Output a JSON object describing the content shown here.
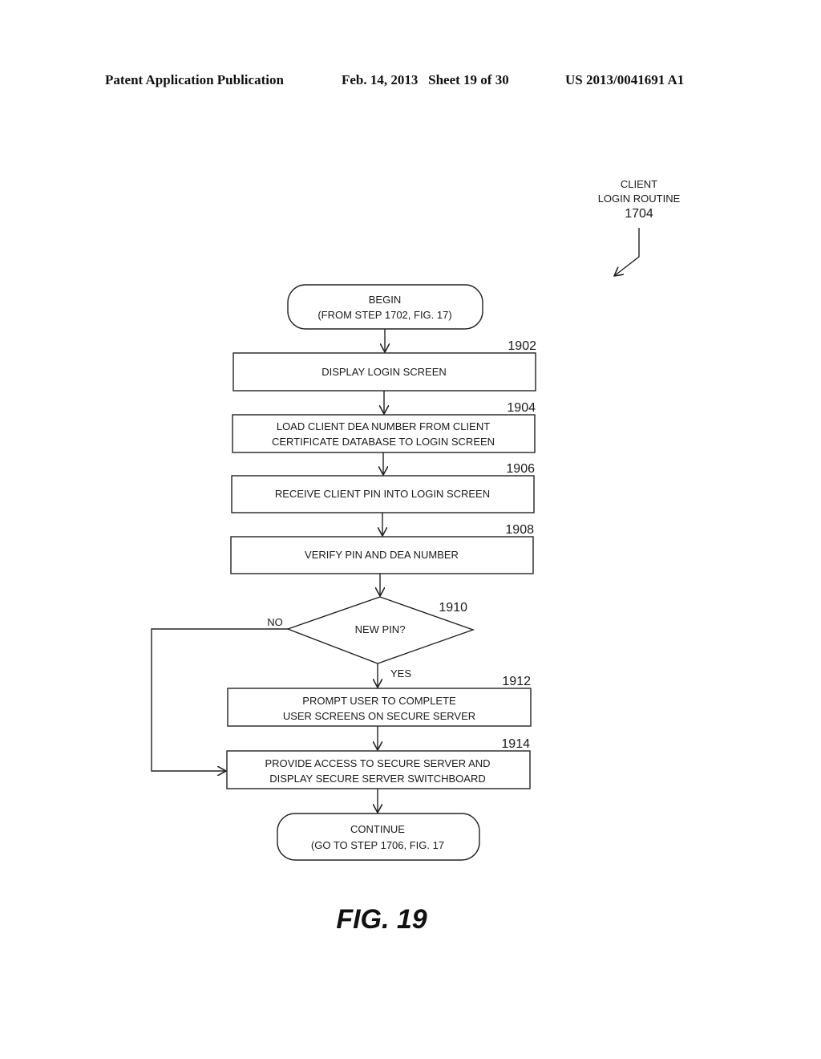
{
  "header": {
    "publication": "Patent Application Publication",
    "date_sheet": "Feb. 14, 2013   Sheet 19 of 30",
    "patent_number": "US 2013/0041691 A1"
  },
  "routine": {
    "line1": "CLIENT",
    "line2": "LOGIN ROUTINE",
    "number": "1704"
  },
  "flow": {
    "begin": {
      "line1": "BEGIN",
      "line2": "(FROM STEP 1702, FIG. 17)"
    },
    "steps": [
      {
        "id": "1902",
        "line1": "DISPLAY LOGIN SCREEN",
        "line2": ""
      },
      {
        "id": "1904",
        "line1": "LOAD CLIENT DEA NUMBER FROM CLIENT",
        "line2": "CERTIFICATE DATABASE TO LOGIN SCREEN"
      },
      {
        "id": "1906",
        "line1": "RECEIVE CLIENT PIN INTO LOGIN SCREEN",
        "line2": ""
      },
      {
        "id": "1908",
        "line1": "VERIFY PIN AND DEA NUMBER",
        "line2": ""
      }
    ],
    "decision": {
      "id": "1910",
      "label": "NEW PIN?",
      "no_label": "NO",
      "yes_label": "YES"
    },
    "step_1912": {
      "id": "1912",
      "line1": "PROMPT USER TO COMPLETE",
      "line2": "USER SCREENS ON SECURE SERVER"
    },
    "step_1914": {
      "id": "1914",
      "line1": "PROVIDE ACCESS TO SECURE SERVER AND",
      "line2": "DISPLAY SECURE SERVER SWITCHBOARD"
    },
    "end": {
      "line1": "CONTINUE",
      "line2": "(GO TO STEP 1706, FIG. 17"
    }
  },
  "figure_label": "FIG. 19"
}
